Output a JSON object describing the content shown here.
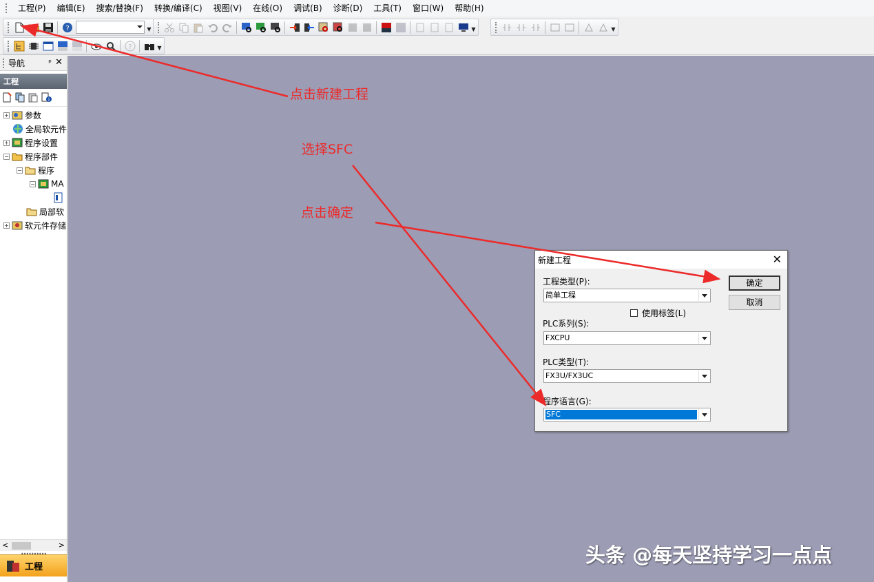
{
  "menu": {
    "items": [
      "工程(P)",
      "编辑(E)",
      "搜索/替换(F)",
      "转换/编译(C)",
      "视图(V)",
      "在线(O)",
      "调试(B)",
      "诊断(D)",
      "工具(T)",
      "窗口(W)",
      "帮助(H)"
    ]
  },
  "toolbar": {
    "icons": {
      "new_project": "new-file-icon",
      "open_project": "open-folder-icon",
      "save_project": "save-icon",
      "help": "help-icon"
    }
  },
  "nav": {
    "title": "导航",
    "pin": "ᵖ",
    "close": "✕",
    "header": "工程",
    "tree": [
      {
        "label": "参数",
        "expander": "+"
      },
      {
        "label": "全局软元件",
        "expander": ""
      },
      {
        "label": "程序设置",
        "expander": "+"
      },
      {
        "label": "程序部件",
        "expander": "−"
      },
      {
        "label": "程序",
        "expander": "−"
      },
      {
        "label": "MA",
        "expander": "−"
      },
      {
        "label": "",
        "expander": ""
      },
      {
        "label": "局部软",
        "expander": ""
      },
      {
        "label": "软元件存储",
        "expander": "+"
      }
    ],
    "bottom_tab": "工程"
  },
  "dialog": {
    "title": "新建工程",
    "close": "✕",
    "project_type_label": "工程类型(P):",
    "project_type_value": "简单工程",
    "use_label_text": "使用标签(L)",
    "use_label_checked": false,
    "plc_series_label": "PLC系列(S):",
    "plc_series_value": "FXCPU",
    "plc_type_label": "PLC类型(T):",
    "plc_type_value": "FX3U/FX3UC",
    "program_language_label": "程序语言(G):",
    "program_language_value": "SFC",
    "ok_button": "确定",
    "cancel_button": "取消"
  },
  "annotations": {
    "click_new": "点击新建工程",
    "select_sfc": "选择SFC",
    "click_ok": "点击确定",
    "color": "#ec2a2a"
  },
  "watermark": "头条 @每天坚持学习一点点"
}
